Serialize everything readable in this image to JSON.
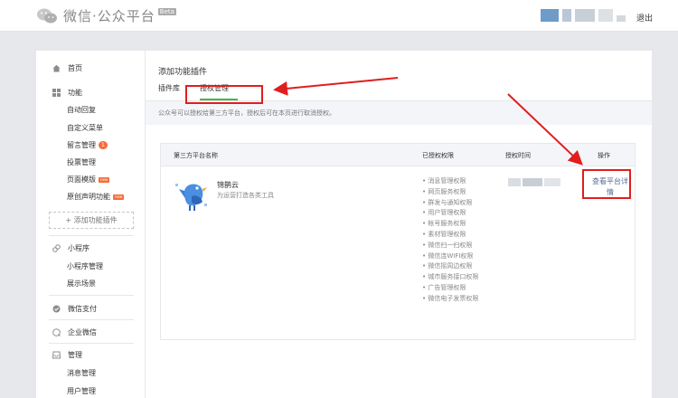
{
  "header": {
    "logo_text": "微信·公众平台",
    "beta": "Beta",
    "logout": "退出",
    "colors": {
      "accent": "#44b549",
      "link": "#576b95",
      "highlight": "#e01e1e",
      "badge": "#f56d3a"
    }
  },
  "sidebar": {
    "home": "首页",
    "function_group": {
      "title": "功能",
      "icon": "grid-icon"
    },
    "function_items": [
      {
        "label": "自动回复"
      },
      {
        "label": "自定义菜单"
      },
      {
        "label": "留言管理",
        "badge": "1"
      },
      {
        "label": "投票管理"
      },
      {
        "label": "页面模版",
        "badge": "new"
      },
      {
        "label": "原创声明功能",
        "badge": "new"
      }
    ],
    "add_plugin": "+ 添加功能插件",
    "miniprogram_group": {
      "title": "小程序"
    },
    "miniprogram_items": [
      {
        "label": "小程序管理"
      },
      {
        "label": "展示场景"
      }
    ],
    "wechat_pay": "微信支付",
    "enterprise_wechat": "企业微信",
    "manage_group": {
      "title": "管理"
    },
    "manage_items": [
      {
        "label": "消息管理"
      },
      {
        "label": "用户管理"
      }
    ]
  },
  "main": {
    "title": "添加功能插件",
    "tabs": [
      {
        "label": "插件库"
      },
      {
        "label": "授权管理"
      }
    ],
    "notice": "公众号可以授权给第三方平台，授权后可在本页进行取消授权。",
    "table": {
      "headers": {
        "name": "第三方平台名称",
        "perms": "已授权权限",
        "time": "授权时间",
        "action": "操作"
      },
      "rows": [
        {
          "name": "锦鹊云",
          "desc": "为运营打造各类工具",
          "permissions": [
            "消息管理权限",
            "网页服务权限",
            "群发与通知权限",
            "用户管理权限",
            "帐号服务权限",
            "素材管理权限",
            "微信扫一扫权限",
            "微信连WIFI权限",
            "微信摇周边权限",
            "城市服务接口权限",
            "广告管理权限",
            "微信电子发票权限"
          ],
          "action": "查看平台详情"
        }
      ]
    }
  }
}
